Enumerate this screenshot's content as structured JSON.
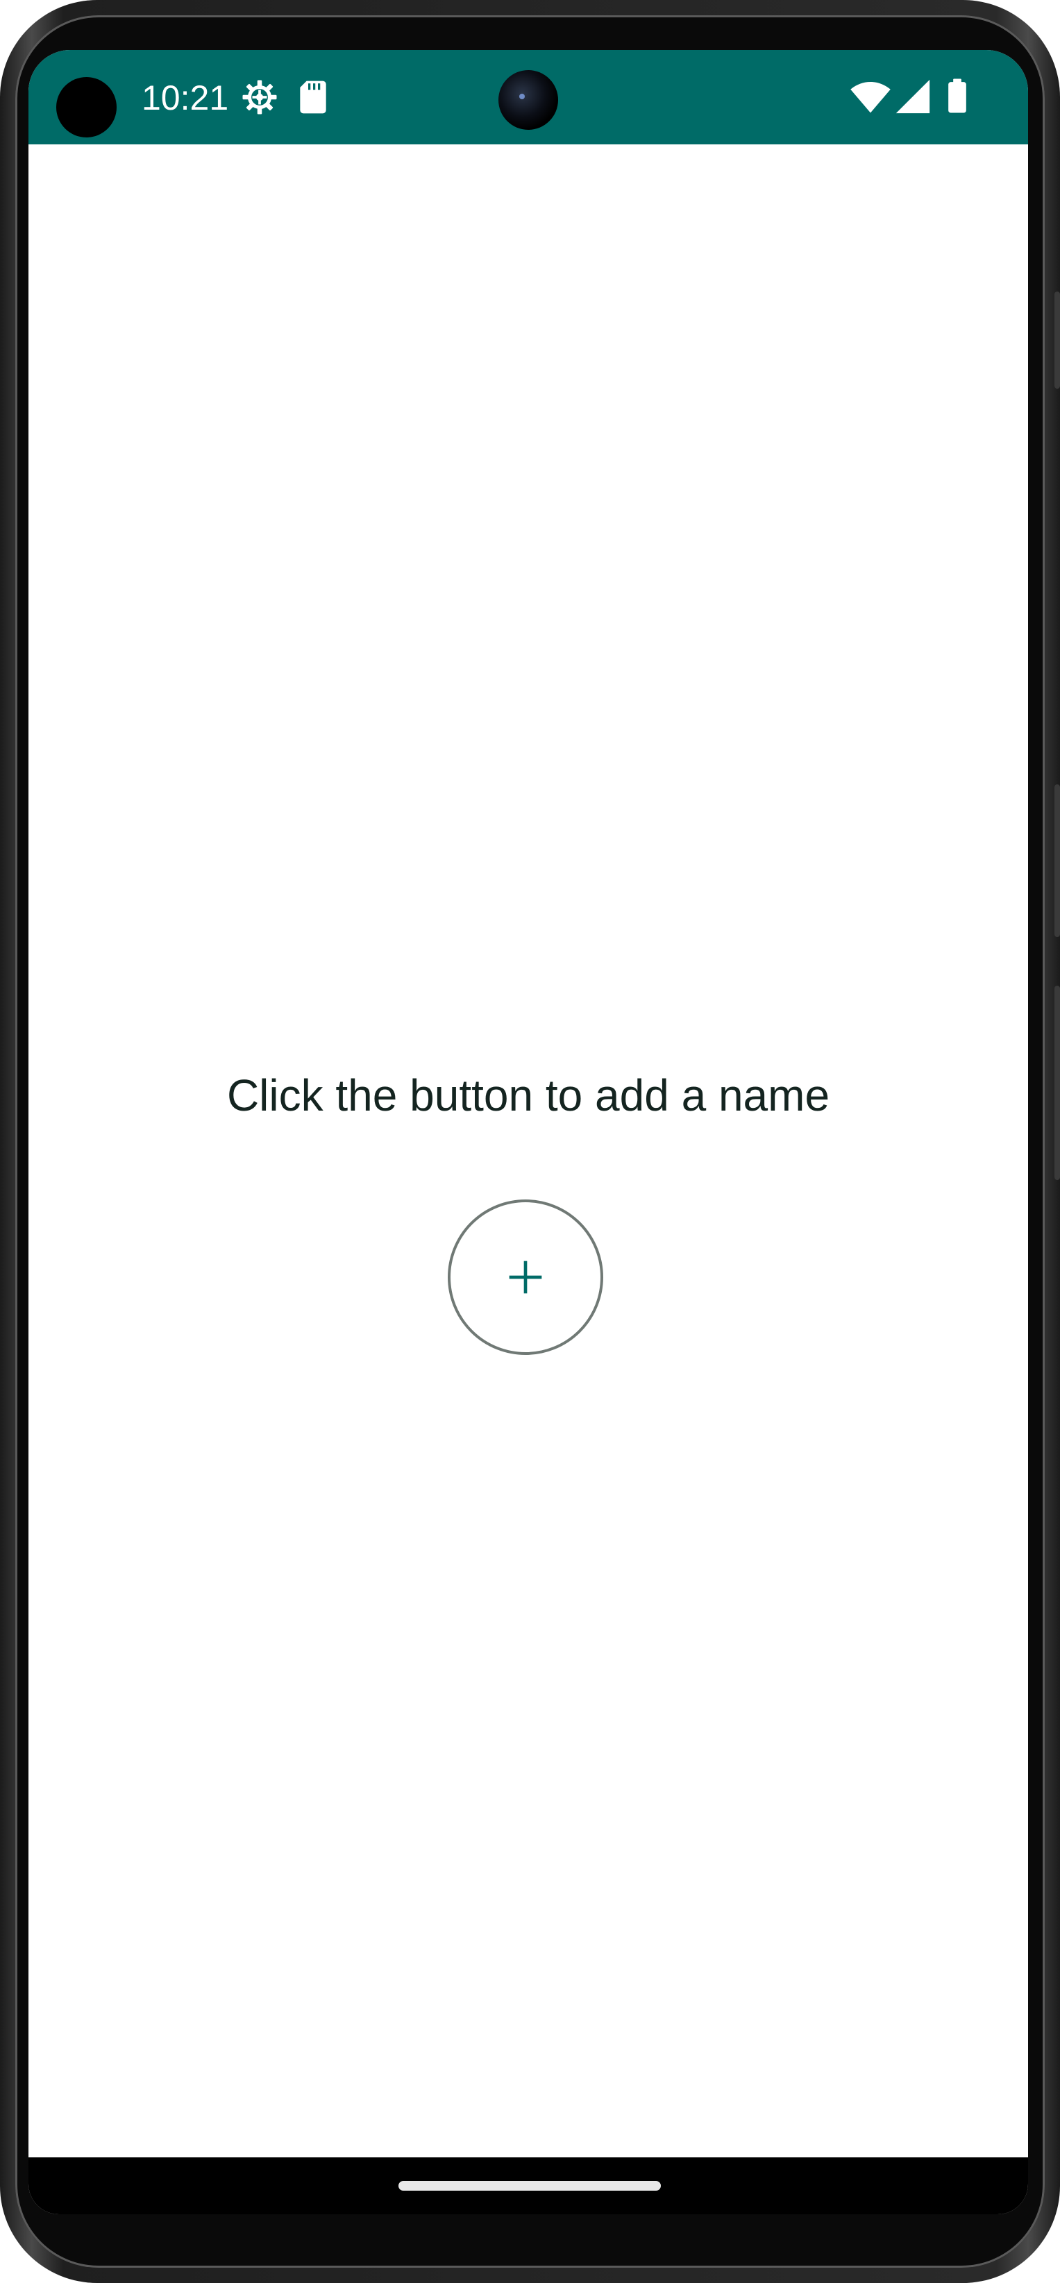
{
  "status_bar": {
    "time": "10:21",
    "background_color": "#006b67",
    "left_icons": [
      "settings-gear-icon",
      "sd-card-icon"
    ],
    "right_icons": [
      "wifi-icon",
      "cellular-signal-icon",
      "battery-icon"
    ]
  },
  "main": {
    "prompt_text": "Click the button to add a name",
    "add_button": {
      "icon": "plus-icon",
      "icon_color": "#006b67",
      "border_color": "#707975"
    }
  },
  "navigation": {
    "handle": "gesture-nav-handle"
  }
}
